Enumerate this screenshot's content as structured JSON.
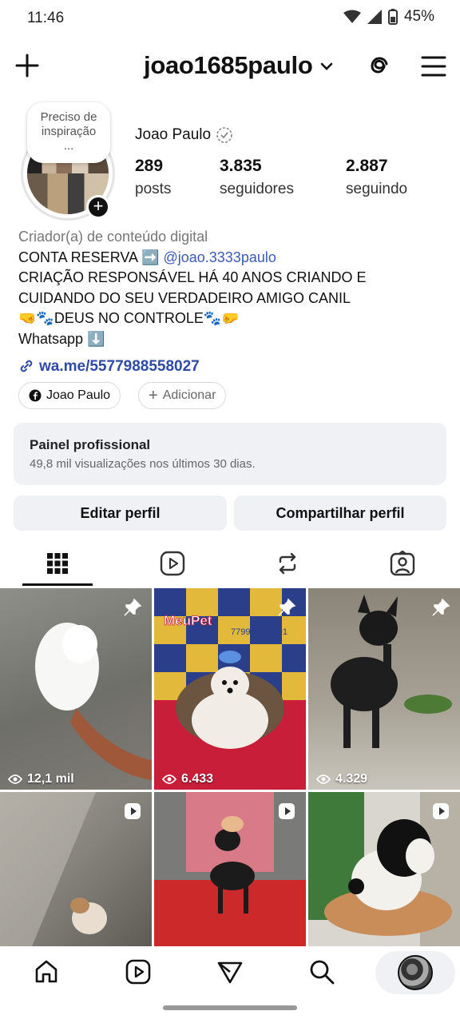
{
  "status_bar": {
    "time": "11:46",
    "battery": "45%"
  },
  "header": {
    "username": "joao1685paulo"
  },
  "profile": {
    "note": [
      "Preciso de",
      "inspiração",
      "..."
    ],
    "display_name": "Joao Paulo",
    "stats": [
      {
        "value": "289",
        "label": "posts"
      },
      {
        "value": "3.835",
        "label": "seguidores"
      },
      {
        "value": "2.887",
        "label": "seguindo"
      }
    ],
    "category": "Criador(a) de conteúdo digital",
    "bio_line1_prefix": "CONTA RESERVA ➡️ ",
    "bio_mention": "@joao.3333paulo",
    "bio_line2": "CRIAÇÃO RESPONSÁVEL HÁ 40 ANOS CRIANDO E",
    "bio_line3": "CUIDANDO DO SEU VERDADEIRO AMIGO CANIL",
    "bio_line4": "🤜🐾DEUS NO CONTROLE🐾🤛",
    "bio_line5": "Whatsapp ⬇️",
    "link": "wa.me/5577988558027",
    "pill_facebook": "Joao Paulo",
    "pill_add": "Adicionar"
  },
  "pro_panel": {
    "title": "Painel profissional",
    "subtitle": "49,8 mil visualizações nos últimos 30 dias."
  },
  "buttons": {
    "edit": "Editar perfil",
    "share": "Compartilhar perfil"
  },
  "posts": [
    {
      "views": "12,1 mil",
      "badge": "pin-icon"
    },
    {
      "views": "6.433",
      "badge": "pin-icon",
      "sign_brand": "MeuPet",
      "sign_phone": "7799167-2491"
    },
    {
      "views": "4.329",
      "badge": "pin-icon"
    },
    {
      "views": "",
      "badge": "reel-icon"
    },
    {
      "views": "",
      "badge": "reel-icon"
    },
    {
      "views": "",
      "badge": "reel-icon"
    }
  ],
  "colors": {
    "accent_link": "#2f4aa6",
    "panel_bg": "#eff1f4"
  }
}
